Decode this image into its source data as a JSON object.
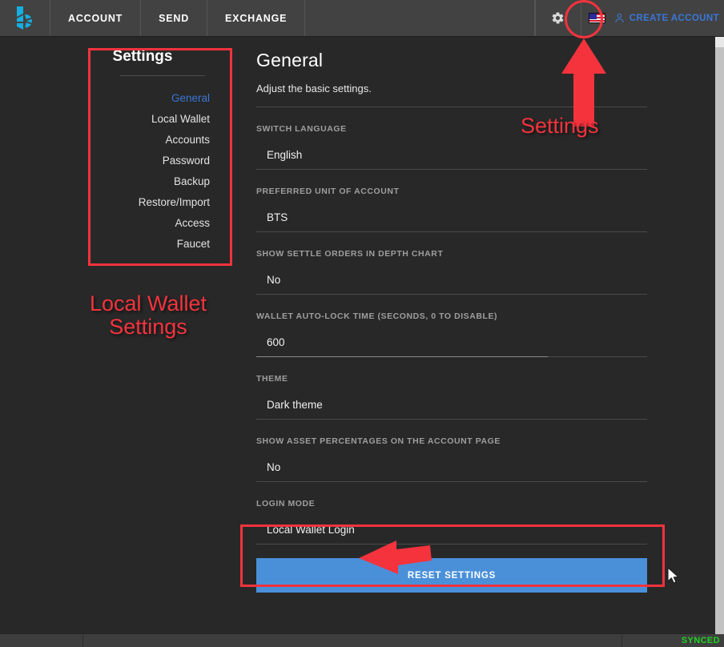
{
  "header": {
    "logo_icon": "bitshares-logo-icon",
    "nav": [
      {
        "label": "ACCOUNT"
      },
      {
        "label": "SEND"
      },
      {
        "label": "EXCHANGE"
      }
    ],
    "gear_icon": "gear-icon",
    "flag_icon": "us-flag-icon",
    "person_icon": "person-icon",
    "create_account_label": "CREATE ACCOUNT"
  },
  "sidebar": {
    "title": "Settings",
    "items": [
      {
        "label": "General",
        "active": true
      },
      {
        "label": "Local Wallet",
        "active": false
      },
      {
        "label": "Accounts",
        "active": false
      },
      {
        "label": "Password",
        "active": false
      },
      {
        "label": "Backup",
        "active": false
      },
      {
        "label": "Restore/Import",
        "active": false
      },
      {
        "label": "Access",
        "active": false
      },
      {
        "label": "Faucet",
        "active": false
      }
    ]
  },
  "content": {
    "title": "General",
    "subtitle": "Adjust the basic settings.",
    "settings": [
      {
        "label": "SWITCH LANGUAGE",
        "value": "English"
      },
      {
        "label": "PREFERRED UNIT OF ACCOUNT",
        "value": "BTS"
      },
      {
        "label": "SHOW SETTLE ORDERS IN DEPTH CHART",
        "value": "No"
      },
      {
        "label": "WALLET AUTO-LOCK TIME (SECONDS, 0 TO DISABLE)",
        "value": "600"
      },
      {
        "label": "THEME",
        "value": "Dark theme"
      },
      {
        "label": "SHOW ASSET PERCENTAGES ON THE ACCOUNT PAGE",
        "value": "No"
      },
      {
        "label": "LOGIN MODE",
        "value": "Local Wallet Login"
      }
    ],
    "reset_button_label": "RESET SETTINGS"
  },
  "statusbar": {
    "sync_status": "SYNCED"
  },
  "annotations": {
    "settings_callout": "Settings",
    "local_wallet_callout": "Local Wallet\nSettings",
    "accent_color": "#f4333d"
  },
  "colors": {
    "header_bg": "#424242",
    "main_bg": "#282828",
    "accent_blue": "#4a90d9",
    "link_blue": "#3a77d6",
    "annotation_red": "#f4333d",
    "synced_green": "#1fd421"
  }
}
